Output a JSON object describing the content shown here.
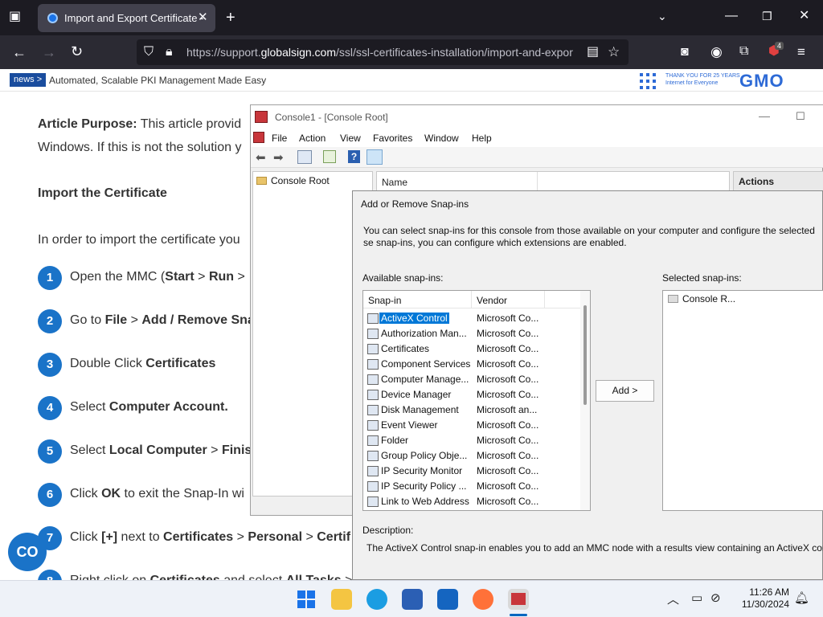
{
  "browser": {
    "tab_title": "Import and Export Certificate -",
    "url_prefix": "https://support.",
    "url_domain": "globalsign.com",
    "url_path": "/ssl/ssl-certificates-installation/import-and-expor",
    "extension_badge": "4"
  },
  "newsbar": {
    "badge": "news >",
    "text": "Automated, Scalable PKI Management Made Easy",
    "gmo_tagline_1": "THANK YOU FOR 25 YEARS",
    "gmo_tagline_2": "Internet for Everyone",
    "gmo_logo": "GMO"
  },
  "article": {
    "purpose_label": "Article Purpose:",
    "purpose_text": " This article provid",
    "purpose_line2": "Windows. If this is not the solution y",
    "import_heading": "Import the Certificate",
    "intro": "In order to import the certificate you",
    "steps": [
      {
        "num": "1",
        "html": "Open the MMC (<b>Start</b> > <b>Run</b> >"
      },
      {
        "num": "2",
        "html": "Go to <b>File</b> > <b>Add / Remove Sna</b>"
      },
      {
        "num": "3",
        "html": "Double Click <b>Certificates</b>"
      },
      {
        "num": "4",
        "html": "Select <b>Computer Account.</b>"
      },
      {
        "num": "5",
        "html": "Select <b>Local Computer</b> > <b>Finis</b>"
      },
      {
        "num": "6",
        "html": "Click <b>OK</b> to exit the Snap-In wi"
      },
      {
        "num": "7",
        "html": "Click <b>[+]</b> next to <b>Certificates</b> > <b>Personal</b> > <b>Certif</b>"
      },
      {
        "num": "8",
        "html": "Right click on <b>Certificates</b> and select <b>All Tasks</b> >"
      }
    ]
  },
  "mmc": {
    "title": "Console1 - [Console Root]",
    "menu": [
      "File",
      "Action",
      "View",
      "Favorites",
      "Window",
      "Help"
    ],
    "tree_root": "Console Root",
    "col_name": "Name",
    "actions_header": "Actions"
  },
  "dialog": {
    "title": "Add or Remove Snap-ins",
    "intro": "You can select snap-ins for this console from those available on your computer and configure the selected se snap-ins, you can configure which extensions are enabled.",
    "available_label": "Available snap-ins:",
    "selected_label": "Selected snap-ins:",
    "col_snapin": "Snap-in",
    "col_vendor": "Vendor",
    "snapins": [
      {
        "name": "ActiveX Control",
        "vendor": "Microsoft Co..."
      },
      {
        "name": "Authorization Man...",
        "vendor": "Microsoft Co..."
      },
      {
        "name": "Certificates",
        "vendor": "Microsoft Co..."
      },
      {
        "name": "Component Services",
        "vendor": "Microsoft Co..."
      },
      {
        "name": "Computer Manage...",
        "vendor": "Microsoft Co..."
      },
      {
        "name": "Device Manager",
        "vendor": "Microsoft Co..."
      },
      {
        "name": "Disk Management",
        "vendor": "Microsoft an..."
      },
      {
        "name": "Event Viewer",
        "vendor": "Microsoft Co..."
      },
      {
        "name": "Folder",
        "vendor": "Microsoft Co..."
      },
      {
        "name": "Group Policy Obje...",
        "vendor": "Microsoft Co..."
      },
      {
        "name": "IP Security Monitor",
        "vendor": "Microsoft Co..."
      },
      {
        "name": "IP Security Policy ...",
        "vendor": "Microsoft Co..."
      },
      {
        "name": "Link to Web Address",
        "vendor": "Microsoft Co..."
      }
    ],
    "add_button": "Add >",
    "selected_item": "Console R...",
    "description_label": "Description:",
    "description_text": "The ActiveX Control snap-in enables you to add an MMC node with a results view containing an ActiveX cor"
  },
  "taskbar": {
    "time": "11:26 AM",
    "date": "11/30/2024"
  },
  "colors": {
    "accent": "#1a73c8",
    "selection": "#0078d7"
  }
}
